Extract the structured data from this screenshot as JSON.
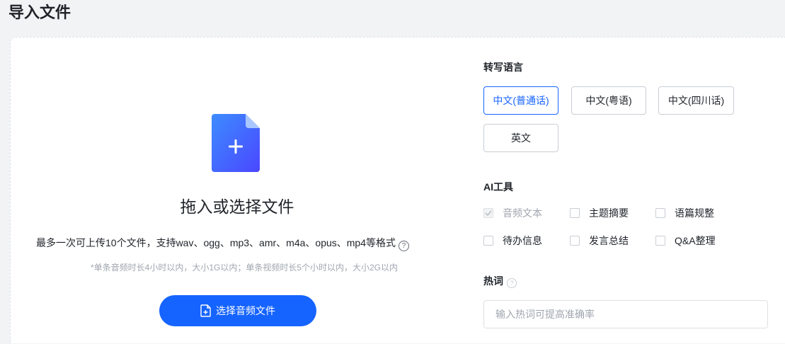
{
  "page": {
    "title": "导入文件"
  },
  "upload": {
    "title": "拖入或选择文件",
    "formats": "最多一次可上传10个文件，支持wav、ogg、mp3、amr、m4a、opus、mp4等格式",
    "limits": "*单条音频时长4小时以内，大小1G以内；单条视频时长5个小时以内，大小2G以内",
    "button_label": "选择音频文件"
  },
  "language": {
    "label": "转写语言",
    "options": [
      "中文(普通话)",
      "中文(粤语)",
      "中文(四川话)",
      "英文"
    ],
    "selected": "中文(普通话)"
  },
  "ai_tools": {
    "label": "AI工具",
    "items": [
      {
        "label": "音频文本",
        "checked": true,
        "disabled": true
      },
      {
        "label": "主题摘要",
        "checked": false,
        "disabled": false
      },
      {
        "label": "语篇规整",
        "checked": false,
        "disabled": false
      },
      {
        "label": "待办信息",
        "checked": false,
        "disabled": false
      },
      {
        "label": "发言总结",
        "checked": false,
        "disabled": false
      },
      {
        "label": "Q&A整理",
        "checked": false,
        "disabled": false
      }
    ]
  },
  "hotwords": {
    "label": "热词",
    "placeholder": "输入热词可提高准确率",
    "value": ""
  },
  "icons": {
    "file_add": "file-plus-icon",
    "help": "question-circle-icon",
    "check": "check-icon"
  },
  "colors": {
    "accent": "#1664ff",
    "text": "#1f2329",
    "muted": "#a0a6af",
    "border": "#c9cdd4"
  }
}
